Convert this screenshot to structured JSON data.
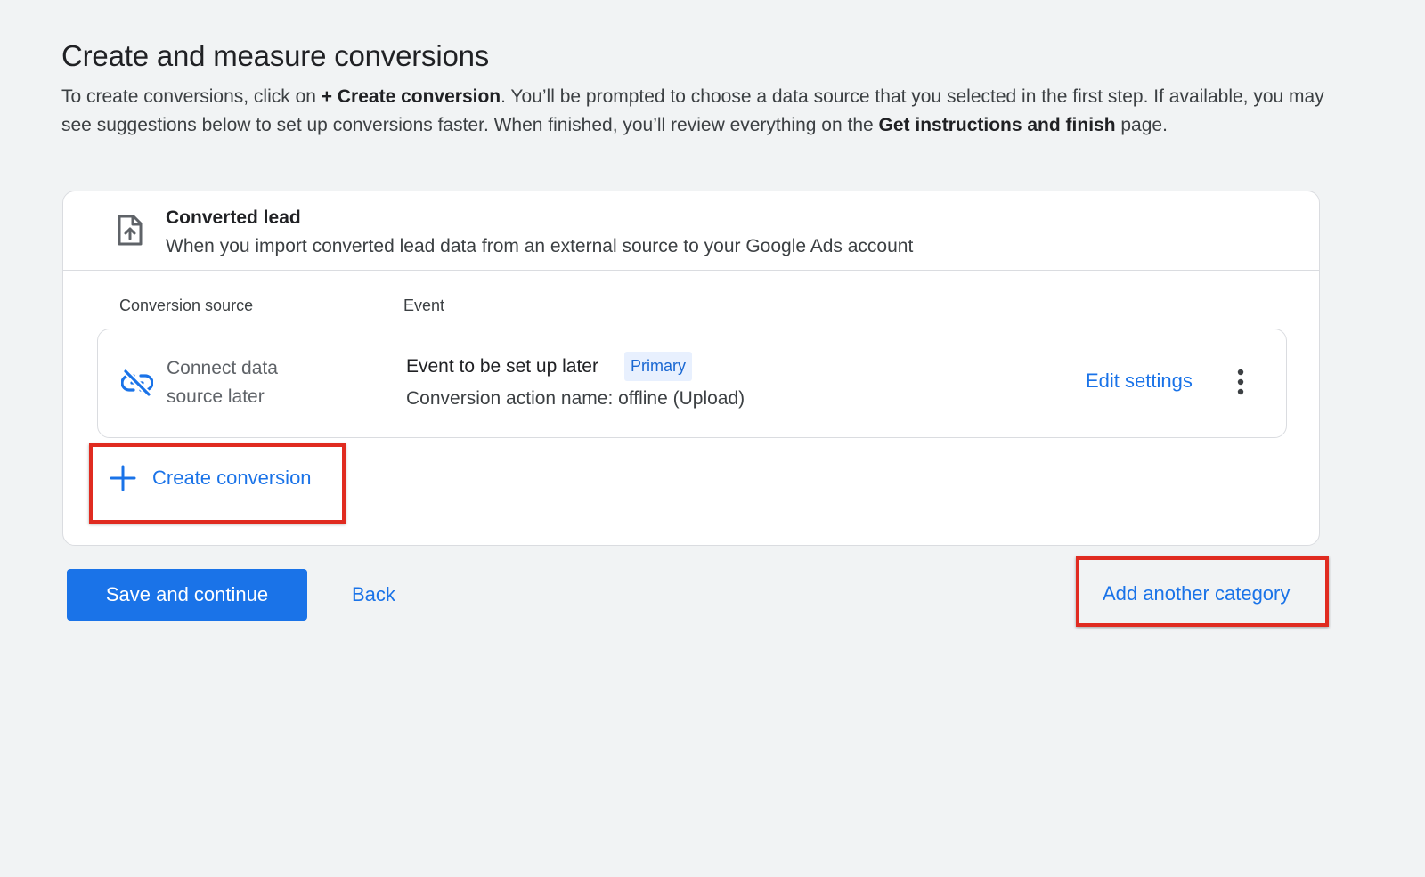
{
  "page": {
    "title": "Create and measure conversions",
    "description": {
      "part1": "To create conversions, click on ",
      "bold1": "+ Create conversion",
      "part2": ". You’ll be prompted to choose a data source that you selected in the first step. If available, you may see suggestions below to set up conversions faster. When finished, you’ll review everything on the ",
      "bold2": "Get instructions and finish",
      "part3": " page."
    }
  },
  "category": {
    "icon": "upload-file-icon",
    "title": "Converted lead",
    "subtitle": "When you import converted lead data from an external source to your Google Ads account",
    "columns": {
      "source": "Conversion source",
      "event": "Event"
    },
    "rows": [
      {
        "source_icon": "link-off-icon",
        "source_label": "Connect data source later",
        "event_name": "Event to be set up later",
        "badge": "Primary",
        "action_name": "Conversion action name: offline (Upload)",
        "edit_label": "Edit settings",
        "more_icon": "more-vert-icon"
      }
    ],
    "create_label": "Create conversion"
  },
  "footer": {
    "save_label": "Save and continue",
    "back_label": "Back",
    "add_category_label": "Add another category"
  },
  "colors": {
    "accent": "#1a73e8",
    "highlight": "#e02b20",
    "badge_bg": "#e8f0fe"
  }
}
